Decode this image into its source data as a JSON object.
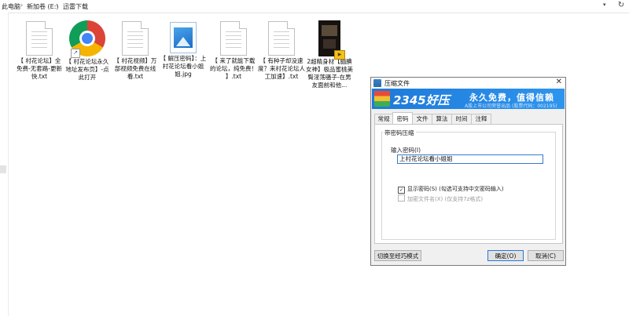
{
  "breadcrumb": {
    "items": [
      "此电脑",
      "新加卷 (E:)",
      "迅雷下载"
    ],
    "separator": "›"
  },
  "address_icons": {
    "dropdown": "chevron-down-icon",
    "refresh": "refresh-icon"
  },
  "files": [
    {
      "name": "【 村花论坛】全免费-无套路-更新快.txt",
      "type": "text-file-icon"
    },
    {
      "name": "【 村花论坛永久地址发布页】-点此打开",
      "type": "chrome-icon"
    },
    {
      "name": "【 村花视频】万部视频免费在线看.txt",
      "type": "text-file-icon"
    },
    {
      "name": "【 解压密码】：上村花论坛看小姐姐.jpg",
      "type": "image-file-icon"
    },
    {
      "name": "【 来了就能下载的论坛，纯免费！ 】.txt",
      "type": "text-file-icon"
    },
    {
      "name": "【 有种子却没速度？来村花论坛人工加速】.txt",
      "type": "text-file-icon"
    },
    {
      "name": "2超精身材【腼腆女神】极品蜜桃美臀淫荡骚子-在男友面前和他...",
      "type": "video-thumbnail"
    }
  ],
  "dialog": {
    "title": "压缩文件",
    "brand": "2345好压",
    "slogan": "永久免费，值得信赖",
    "subtitle": "A股上市公司荣誉出品 (股票代码：002195)",
    "tabs": [
      "常规",
      "密码",
      "文件",
      "算法",
      "时间",
      "注释"
    ],
    "active_tab": "密码",
    "group_label": "带密码压缩",
    "password_label": "输入密码(I)",
    "password_value": "上村花论坛看小姐姐",
    "show_password": {
      "label": "显示密码(S)  (勾选可支持中文密码输入)",
      "checked": true
    },
    "encrypt_names": {
      "label": "加密文件名(X)  (仅支持7z格式)",
      "checked": false,
      "disabled": true
    },
    "switch_button": "切换至经巧模式",
    "ok_button": "确定(O)",
    "cancel_button": "取消(C)"
  },
  "colors": {
    "banner": "#2185e3",
    "accent": "#2a78d6"
  }
}
